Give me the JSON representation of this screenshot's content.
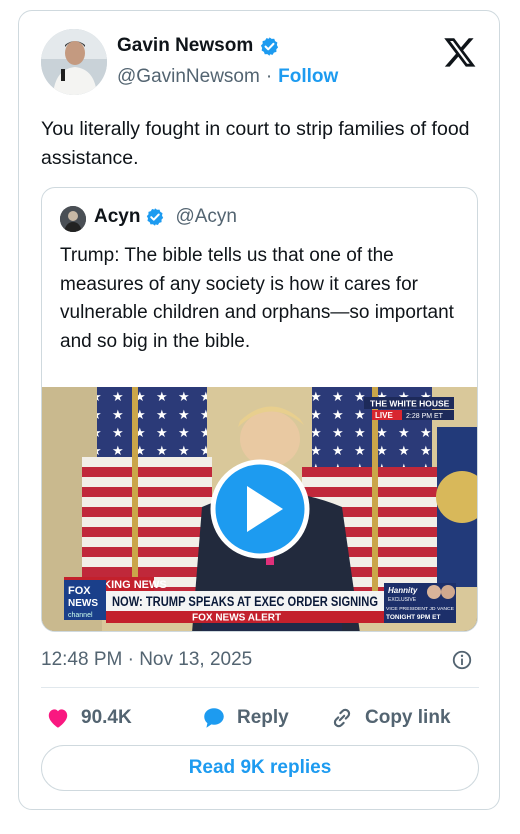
{
  "author": {
    "name": "Gavin Newsom",
    "handle": "@GavinNewsom",
    "separator": "·",
    "follow_label": "Follow"
  },
  "tweet": {
    "text": "You literally fought in court to strip families of food assistance.",
    "timestamp": "12:48 PM · Nov 13, 2025"
  },
  "quote": {
    "name": "Acyn",
    "handle": "@Acyn",
    "text": "Trump: The bible tells us that one of the measures of any society is how it cares for vulnerable children and orphans—so important and so big in the bible.",
    "video": {
      "white_house_label": "THE WHITE HOUSE",
      "live_label": "LIVE",
      "live_time": "2:28 PM ET",
      "breaking_label": "BREAKING NEWS",
      "headline": "NOW: TRUMP SPEAKS AT EXEC ORDER SIGNING",
      "alert_label": "FOX NEWS ALERT",
      "network_top": "FOX",
      "network_mid": "NEWS",
      "network_bottom": "channel",
      "promo_show": "Hannity",
      "promo_tag": "EXCLUSIVE",
      "promo_guest": "VICE PRESIDENT JD VANCE",
      "promo_time": "TONIGHT 9PM ET"
    }
  },
  "actions": {
    "likes": "90.4K",
    "reply_label": "Reply",
    "copy_label": "Copy link",
    "read_replies_label": "Read 9K replies"
  },
  "colors": {
    "accent": "#1d9bf0",
    "like": "#f91880",
    "muted": "#536471"
  },
  "icons": [
    "verified-badge-icon",
    "x-logo-icon",
    "play-icon",
    "info-icon",
    "heart-icon",
    "reply-bubble-icon",
    "link-icon"
  ]
}
